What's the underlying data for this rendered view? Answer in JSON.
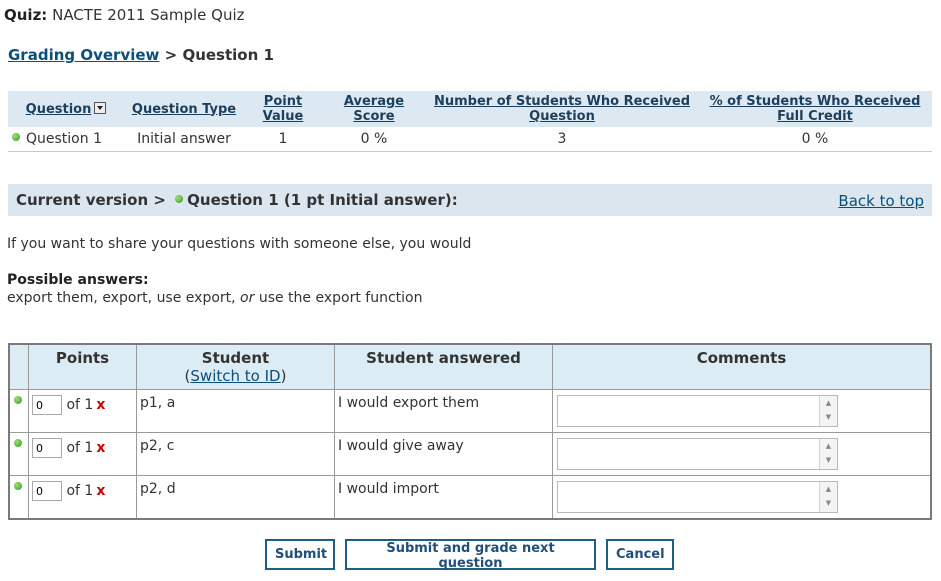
{
  "quiz": {
    "label": "Quiz:",
    "name": "NACTE 2011 Sample Quiz"
  },
  "breadcrumb": {
    "link": "Grading Overview",
    "separator": ">",
    "current": "Question 1"
  },
  "overview": {
    "headers": [
      "Question",
      "Question Type",
      "Point Value",
      "Average Score",
      "Number of Students Who Received Question",
      "% of Students Who Received Full Credit"
    ],
    "row": {
      "question": "Question 1",
      "type": "Initial answer",
      "points": "1",
      "avg": "0 %",
      "received": "3",
      "full_credit": "0 %"
    }
  },
  "version_bar": {
    "prefix": "Current version >",
    "title": "Question 1 (1 pt Initial answer):",
    "back": "Back to top"
  },
  "question_text": "If you want to share your questions with someone else, you would",
  "possible": {
    "label": "Possible answers:",
    "answers_a": "export them, export, use export,",
    "or": "or",
    "answers_b": "use the export function"
  },
  "grading": {
    "headers": {
      "points": "Points",
      "student": "Student",
      "switch_open": "(",
      "switch_link": "Switch to ID",
      "switch_close": ")",
      "answered": "Student answered",
      "comments": "Comments"
    },
    "rows": [
      {
        "points": "0",
        "of": "of 1",
        "x": "x",
        "student": "p1, a",
        "answer": "I would export them"
      },
      {
        "points": "0",
        "of": "of 1",
        "x": "x",
        "student": "p2, c",
        "answer": "I would give away"
      },
      {
        "points": "0",
        "of": "of 1",
        "x": "x",
        "student": "p2, d",
        "answer": "I would import"
      }
    ]
  },
  "buttons": {
    "submit": "Submit",
    "submit_next": "Submit and grade next question",
    "cancel": "Cancel"
  }
}
